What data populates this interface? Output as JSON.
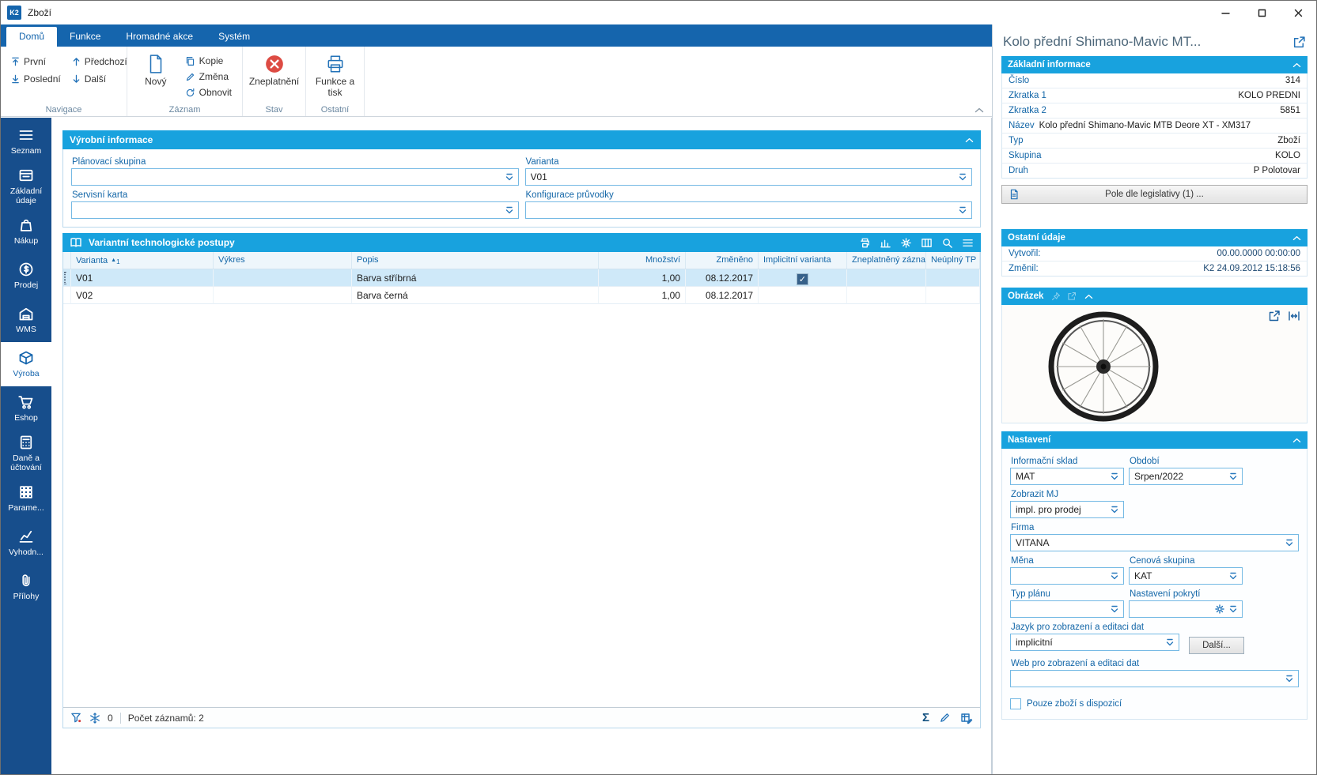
{
  "window": {
    "logo": "K2",
    "title": "Zboží"
  },
  "icons": {
    "check": "✓",
    "sort_asc": "▲",
    "sum": "Σ"
  },
  "ribbon": {
    "tabs": [
      {
        "label": "Domů"
      },
      {
        "label": "Funkce"
      },
      {
        "label": "Hromadné akce"
      },
      {
        "label": "Systém"
      }
    ],
    "nav_group": {
      "label": "Navigace",
      "items": [
        {
          "label": "První"
        },
        {
          "label": "Poslední"
        },
        {
          "label": "Předchozí"
        },
        {
          "label": "Další"
        }
      ]
    },
    "record_group": {
      "label": "Záznam",
      "new_label": "Nový",
      "items": [
        {
          "label": "Kopie"
        },
        {
          "label": "Změna"
        },
        {
          "label": "Obnovit"
        }
      ]
    },
    "state_group": {
      "label": "Stav",
      "invalidate_label": "Zneplatnění"
    },
    "other_group": {
      "label": "Ostatní",
      "print_label": "Funkce a tisk"
    }
  },
  "sidebar": {
    "items": [
      {
        "label": "Seznam"
      },
      {
        "label": "Základní údaje"
      },
      {
        "label": "Nákup"
      },
      {
        "label": "Prodej"
      },
      {
        "label": "WMS"
      },
      {
        "label": "Výroba"
      },
      {
        "label": "Eshop"
      },
      {
        "label": "Daně a účtování"
      },
      {
        "label": "Parame..."
      },
      {
        "label": "Vyhodn..."
      },
      {
        "label": "Přílohy"
      }
    ]
  },
  "production": {
    "title": "Výrobní informace",
    "planning_group_label": "Plánovací skupina",
    "planning_group_value": "",
    "variant_label": "Varianta",
    "variant_value": "V01",
    "service_card_label": "Servisní karta",
    "service_card_value": "",
    "config_label": "Konfigurace průvodky",
    "config_value": ""
  },
  "routings": {
    "title": "Variantní technologické postupy",
    "columns": {
      "varianta": "Varianta",
      "vykres": "Výkres",
      "popis": "Popis",
      "mnozstvi": "Množství",
      "zmeneno": "Změněno",
      "implicitni": "Implicitní varianta",
      "zneplatneny": "Zneplatněný záznam",
      "neuplny": "Neúplný TP"
    },
    "sort_indicator": "1",
    "rows": [
      {
        "varianta": "V01",
        "vykres": "",
        "popis": "Barva stříbrná",
        "mnozstvi": "1,00",
        "zmeneno": "08.12.2017",
        "implicitni": true
      },
      {
        "varianta": "V02",
        "vykres": "",
        "popis": "Barva černá",
        "mnozstvi": "1,00",
        "zmeneno": "08.12.2017",
        "implicitni": false
      }
    ],
    "status": {
      "flag_count": "0",
      "record_count": "Počet záznamů: 2"
    }
  },
  "detail": {
    "title": "Kolo přední Shimano-Mavic MT...",
    "basic": {
      "title": "Základní informace",
      "rows": [
        {
          "label": "Číslo",
          "value": "314"
        },
        {
          "label": "Zkratka 1",
          "value": "KOLO PŘEDNÍ"
        },
        {
          "label": "Zkratka 2",
          "value": "5851"
        },
        {
          "label": "Název",
          "value": "Kolo přední Shimano-Mavic MTB Deore XT - XM317"
        },
        {
          "label": "Typ",
          "value": "Zboží"
        },
        {
          "label": "Skupina",
          "value": "KOLO"
        },
        {
          "label": "Druh",
          "value": "P Polotovar"
        }
      ],
      "legislative_button": "Pole dle legislativy (1) ..."
    },
    "other": {
      "title": "Ostatní údaje",
      "rows": [
        {
          "label": "Vytvořil:",
          "value": "00.00.0000 00:00:00"
        },
        {
          "label": "Změnil:",
          "value": "K2 24.09.2012 15:18:56"
        }
      ]
    },
    "image": {
      "title": "Obrázek"
    },
    "settings": {
      "title": "Nastavení",
      "info_warehouse_label": "Informační sklad",
      "info_warehouse_value": "MAT",
      "period_label": "Období",
      "period_value": "Srpen/2022",
      "display_mj_label": "Zobrazit MJ",
      "display_mj_value": "impl. pro prodej",
      "company_label": "Firma",
      "company_value": "VITANA",
      "currency_label": "Měna",
      "currency_value": "",
      "price_group_label": "Cenová skupina",
      "price_group_value": "KAT",
      "plan_type_label": "Typ plánu",
      "plan_type_value": "",
      "coverage_label": "Nastavení pokrytí",
      "coverage_value": "",
      "language_label": "Jazyk pro zobrazení a editaci dat",
      "language_value": "implicitní",
      "more_button": "Další...",
      "web_label": "Web pro zobrazení a editaci dat",
      "web_value": "",
      "only_available_label": "Pouze zboží s dispozicí"
    }
  },
  "colors": {
    "accent_blue": "#1565ad",
    "sidebar_blue": "#174e8c",
    "header_cyan": "#18a2de",
    "label_blue": "#1467a8",
    "danger_red": "#dd4b43"
  }
}
